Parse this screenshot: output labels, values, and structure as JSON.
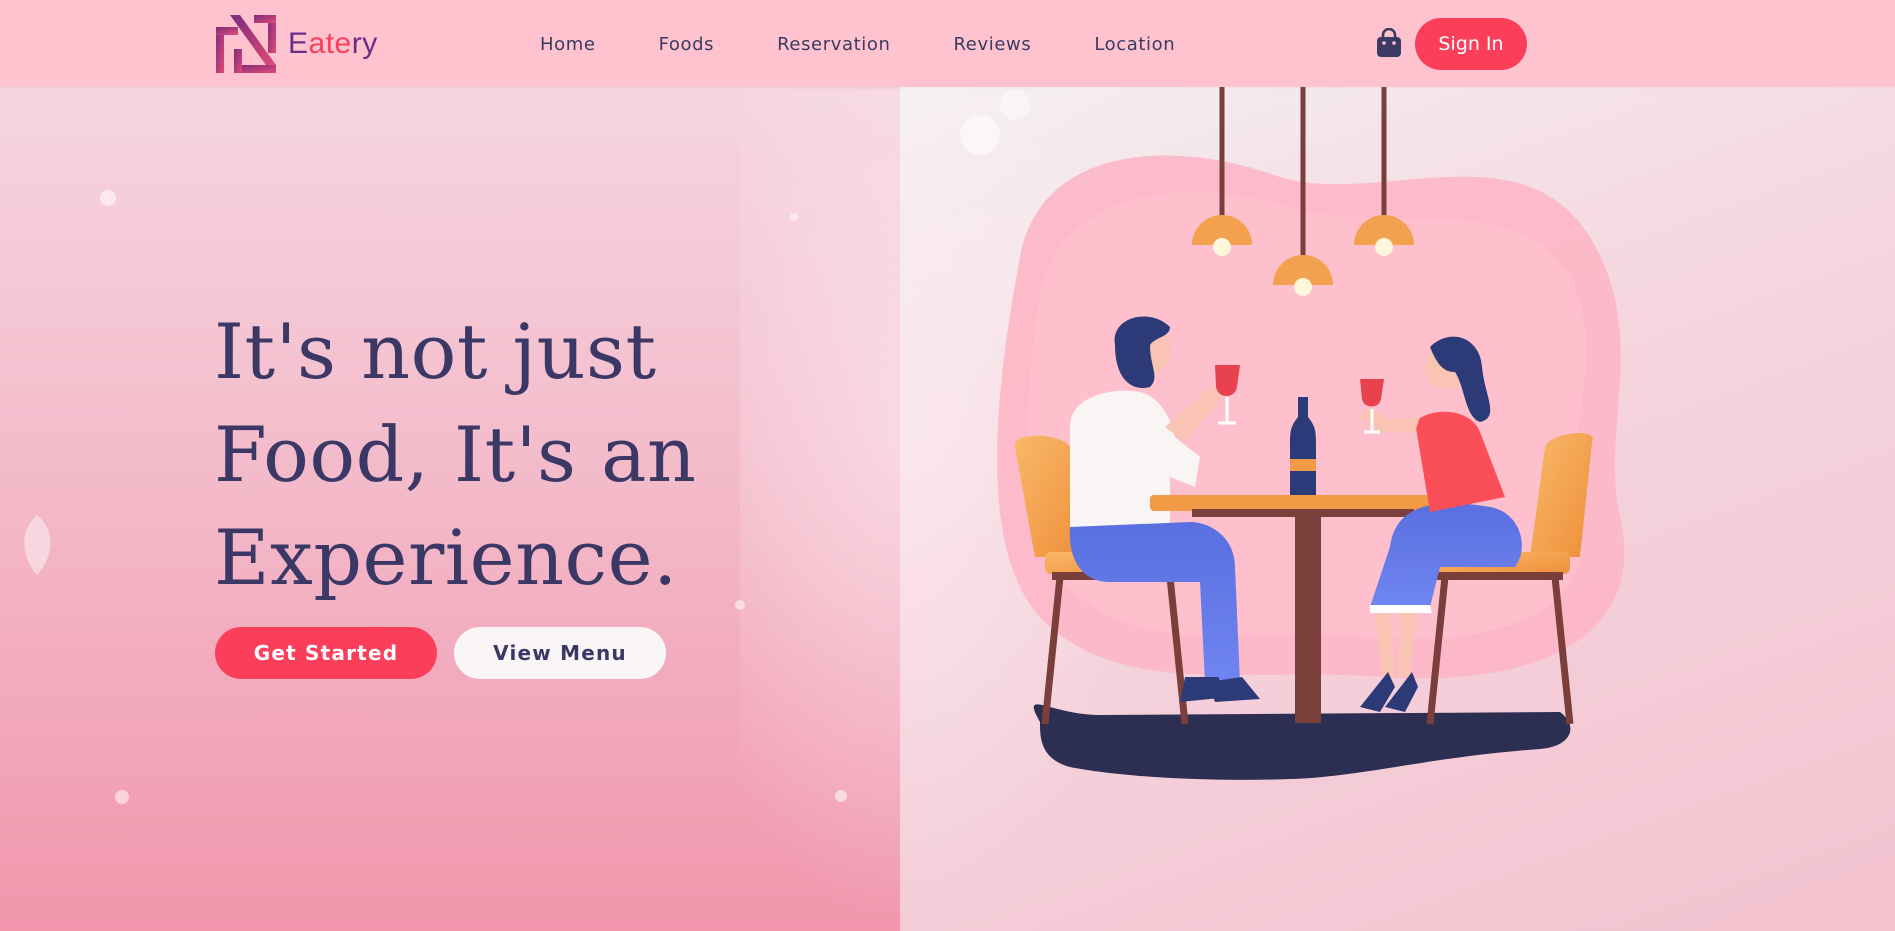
{
  "brand": {
    "name_part1": "E",
    "name_accent": "ate",
    "name_part2": "ry"
  },
  "nav": {
    "items": [
      "Home",
      "Foods",
      "Reservation",
      "Reviews",
      "Location"
    ]
  },
  "header": {
    "sign_in_label": "Sign In",
    "cart_icon": "shopping-bag-icon"
  },
  "hero": {
    "headline": "It's not just Food, It's an Experience.",
    "primary_button": "Get Started",
    "secondary_button": "View Menu"
  },
  "colors": {
    "accent": "#fb3f5a",
    "heading": "#3b3866",
    "header_bg": "#fec3cf",
    "logo_purple": "#6a2e86"
  }
}
